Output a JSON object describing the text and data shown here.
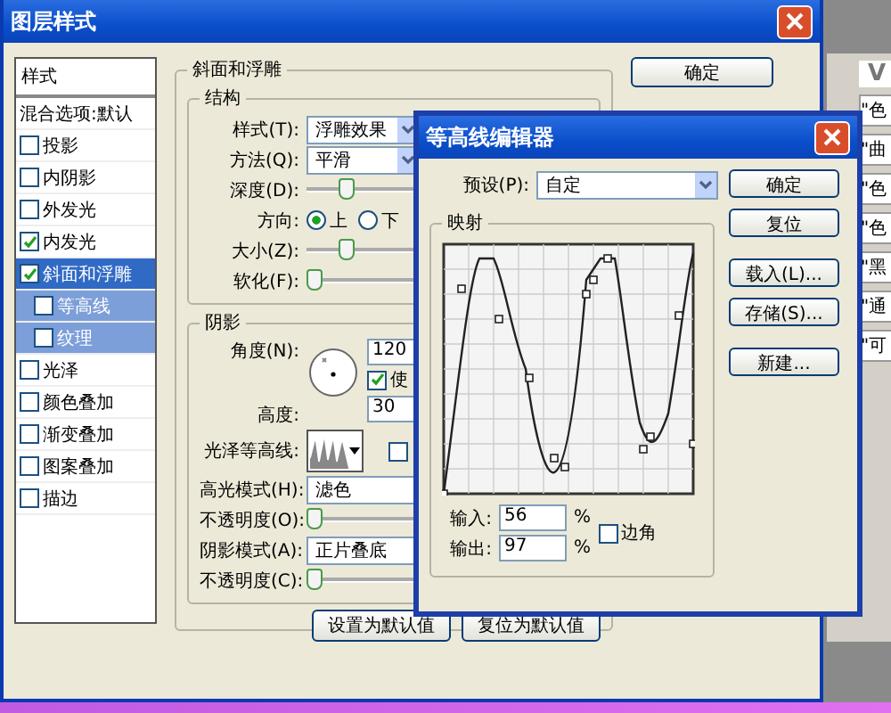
{
  "layer_style_window": {
    "title": "图层样式",
    "list_header": "样式",
    "blend_options": "混合选项:默认",
    "styles": [
      {
        "label": "投影",
        "checked": false,
        "selected": false
      },
      {
        "label": "内阴影",
        "checked": false,
        "selected": false
      },
      {
        "label": "外发光",
        "checked": false,
        "selected": false
      },
      {
        "label": "内发光",
        "checked": true,
        "selected": false
      },
      {
        "label": "斜面和浮雕",
        "checked": true,
        "selected": true,
        "children": [
          {
            "label": "等高线",
            "checked": false,
            "selected": false
          },
          {
            "label": "纹理",
            "checked": false,
            "selected": false
          }
        ]
      },
      {
        "label": "光泽",
        "checked": false,
        "selected": false
      },
      {
        "label": "颜色叠加",
        "checked": false,
        "selected": false
      },
      {
        "label": "渐变叠加",
        "checked": false,
        "selected": false
      },
      {
        "label": "图案叠加",
        "checked": false,
        "selected": false
      },
      {
        "label": "描边",
        "checked": false,
        "selected": false
      }
    ],
    "section_title": "斜面和浮雕",
    "structure": {
      "title": "结构",
      "rows": [
        {
          "kind": "select",
          "label": "样式(T):",
          "value": "浮雕效果"
        },
        {
          "kind": "select",
          "label": "方法(Q):",
          "value": "平滑"
        },
        {
          "kind": "slider",
          "label": "深度(D):",
          "level": 0.2
        },
        {
          "kind": "radio",
          "label": "方向:",
          "options": [
            {
              "label": "上",
              "selected": true
            },
            {
              "label": "下",
              "selected": false
            }
          ]
        },
        {
          "kind": "slider",
          "label": "大小(Z):",
          "level": 0.2
        },
        {
          "kind": "slider",
          "label": "软化(F):",
          "level": 0.0
        }
      ]
    },
    "shading": {
      "title": "阴影",
      "angle_label": "角度(N):",
      "angle": "120",
      "global_light_label": "使",
      "global_light": true,
      "altitude_label": "高度:",
      "altitude": "30",
      "gloss_label": "光泽等高线:",
      "anti_alias": false,
      "rows": [
        {
          "kind": "select",
          "label": "高光模式(H):",
          "value": "滤色"
        },
        {
          "kind": "slider",
          "label": "不透明度(O):",
          "level": 0.0
        },
        {
          "kind": "select",
          "label": "阴影模式(A):",
          "value": "正片叠底"
        },
        {
          "kind": "slider",
          "label": "不透明度(C):",
          "level": 0.0
        }
      ]
    },
    "bottom_buttons": [
      "设置为默认值",
      "复位为默认值"
    ],
    "buttons": [
      "确定"
    ]
  },
  "side_panel": {
    "letter": "V",
    "items": [
      "\"色",
      "\"曲",
      "\"色",
      "\"色",
      "\"黑",
      "\"通",
      "\"可"
    ]
  },
  "contour_editor": {
    "title": "等高线编辑器",
    "preset_label": "预设(P):",
    "preset": "自定",
    "mapping_title": "映射",
    "input_label": "输入:",
    "input": "56",
    "output_label": "输出:",
    "output": "97",
    "unit": "%",
    "corner_label": "边角",
    "corner": false,
    "buttons": [
      "确定",
      "复位",
      "载入(L)...",
      "存储(S)...",
      "新建..."
    ]
  }
}
